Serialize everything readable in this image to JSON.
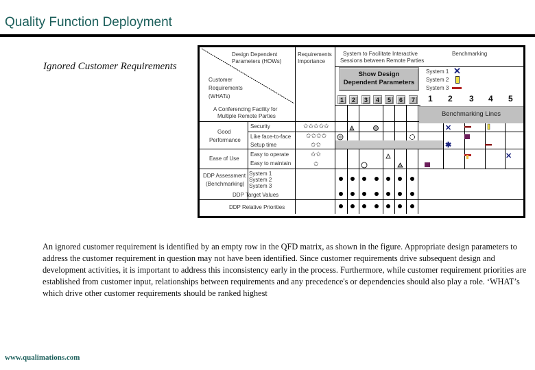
{
  "page": {
    "title": "Quality Function Deployment",
    "subtitle": "Ignored Customer Requirements",
    "paragraph": "An ignored customer requirement is identified by an empty row in the QFD matrix, as shown in the figure. Appropriate design parameters to address the customer requirement in question may not have been identified. Since customer requirements drive subsequent design and development activities, it is important to address this inconsistency early in the process. Furthermore, while customer requirement priorities are established from customer input, relationships between requirements and any precedence's or dependencies should also play a role. ‘WHAT’s which drive other customer requirements should be ranked highest",
    "footer": "www.qualimations.com",
    "colors": {
      "title": "#1b5e5a",
      "button_gray": "#c0c0c0",
      "system1": "#1a237e",
      "system2": "#f0e040",
      "system3": "#b22222"
    }
  },
  "matrix": {
    "corner_top": "Design Dependent Parameters (HOWs)",
    "corner_top_l1": "Design Dependent",
    "corner_top_l2": "Parameters (HOWs)",
    "corner_bottom_l1": "Customer",
    "corner_bottom_l2": "Requirements",
    "corner_bottom_l3": "(WHATs)",
    "importance_l1": "Requirements",
    "importance_l2": "Importance",
    "system_l1": "System to Facilitate Interactive",
    "system_l2": "Sessions between Remote Parties",
    "benchmarking_header": "Benchmarking",
    "show_button_l1": "Show Design",
    "show_button_l2": "Dependent Parameters",
    "ddp_numbers": [
      "1",
      "2",
      "3",
      "4",
      "5",
      "6",
      "7"
    ],
    "legend": [
      {
        "label": "System 1",
        "icon": "x-mark-icon"
      },
      {
        "label": "System 2",
        "icon": "yellow-bar-icon"
      },
      {
        "label": "System 3",
        "icon": "red-bar-icon"
      }
    ],
    "bench_numbers": [
      "1",
      "2",
      "3",
      "4",
      "5"
    ],
    "bench_lines_label": "Benchmarking Lines",
    "facility_l1": "A Conferencing Facility for",
    "facility_l2": "Multiple Remote Parties",
    "groups": [
      {
        "label_l1": "Good",
        "label_l2": "Performance",
        "items": [
          "Security",
          "Like face-to-face",
          "Setup time"
        ]
      },
      {
        "label_l1": "Ease of Use",
        "label_l2": "",
        "items": [
          "Easy to operate",
          "Easy to maintain"
        ]
      }
    ],
    "importance_values": [
      "✩✩✩✩✩",
      "✩✩✩✩",
      "✩✩",
      "✩✩",
      "✩"
    ],
    "relationships": [
      {
        "row": 0,
        "col": 2,
        "symbol": "triangle-filled"
      },
      {
        "row": 0,
        "col": 4,
        "symbol": "circle-filled"
      },
      {
        "row": 1,
        "col": 1,
        "symbol": "double-circle"
      },
      {
        "row": 1,
        "col": 7,
        "symbol": "circle-open"
      },
      {
        "row": 3,
        "col": 5,
        "symbol": "triangle-open"
      },
      {
        "row": 4,
        "col": 3,
        "symbol": "circle-open"
      },
      {
        "row": 4,
        "col": 6,
        "symbol": "triangle-filled"
      }
    ],
    "ignored_row": "Setup time",
    "assessment_l1": "DDP Assessment",
    "assessment_l2": "(Benchmarking)",
    "assessment_systems": [
      "System 1",
      "System 2",
      "System 3"
    ],
    "target_values_label": "DDP Target Values",
    "relative_priorities_label": "DDP Relative Priorities"
  }
}
